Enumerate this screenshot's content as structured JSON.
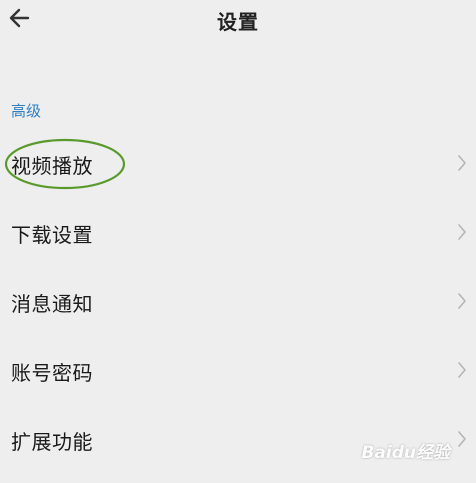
{
  "header": {
    "back_icon": "arrow-left-icon",
    "title": "设置"
  },
  "section": {
    "label": "高级"
  },
  "items": [
    {
      "label": "视频播放",
      "icon": "chevron-right-icon"
    },
    {
      "label": "下载设置",
      "icon": "chevron-right-icon"
    },
    {
      "label": "消息通知",
      "icon": "chevron-right-icon"
    },
    {
      "label": "账号密码",
      "icon": "chevron-right-icon"
    },
    {
      "label": "扩展功能",
      "icon": "chevron-right-icon"
    }
  ],
  "annotation": {
    "highlight_color": "#5a9a2c"
  },
  "watermark": {
    "text": "Baidu经验"
  }
}
